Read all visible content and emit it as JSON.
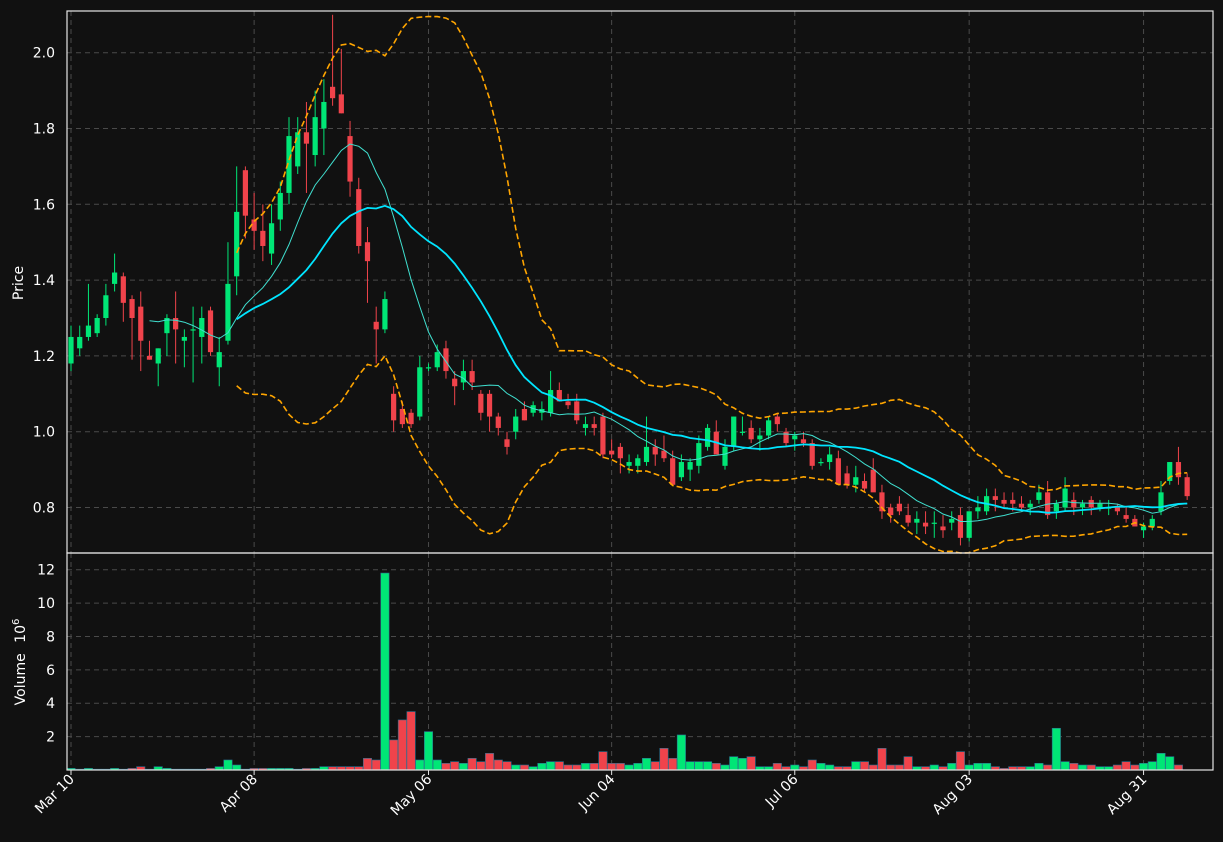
{
  "chart_data": {
    "type": "candlestick",
    "colors": {
      "up": "#00e676",
      "down": "#f0434b",
      "sma_fast": "#40e0d0",
      "sma_slow": "#00e5ff",
      "bollinger": "#ffa500",
      "background": "#111111",
      "grid": "#4a4a4a",
      "text": "#ffffff"
    },
    "price_axis": {
      "label": "Price",
      "ylim": [
        0.68,
        2.11
      ],
      "ticks": [
        "0.8",
        "1.0",
        "1.2",
        "1.4",
        "1.6",
        "1.8",
        "2.0"
      ],
      "grid": true
    },
    "volume_axis": {
      "label": "Volume",
      "exponent": "6",
      "ylim": [
        0,
        13
      ],
      "ticks": [
        "2",
        "4",
        "6",
        "8",
        "10",
        "12"
      ],
      "grid": true
    },
    "x_tick_labels": [
      {
        "label": "Mar 10",
        "index": 0
      },
      {
        "label": "Apr 08",
        "index": 21
      },
      {
        "label": "May 06",
        "index": 41
      },
      {
        "label": "Jun 04",
        "index": 62
      },
      {
        "label": "Jul 06",
        "index": 83
      },
      {
        "label": "Aug 03",
        "index": 103
      },
      {
        "label": "Aug 31",
        "index": 123
      }
    ],
    "ohlc": [
      [
        1.18,
        1.28,
        1.16,
        1.25
      ],
      [
        1.22,
        1.28,
        1.2,
        1.25
      ],
      [
        1.25,
        1.39,
        1.24,
        1.28
      ],
      [
        1.26,
        1.31,
        1.25,
        1.3
      ],
      [
        1.3,
        1.39,
        1.28,
        1.36
      ],
      [
        1.39,
        1.47,
        1.37,
        1.42
      ],
      [
        1.41,
        1.42,
        1.29,
        1.34
      ],
      [
        1.35,
        1.36,
        1.19,
        1.3
      ],
      [
        1.33,
        1.37,
        1.16,
        1.24
      ],
      [
        1.2,
        1.24,
        1.19,
        1.19
      ],
      [
        1.18,
        1.22,
        1.12,
        1.22
      ],
      [
        1.26,
        1.31,
        1.2,
        1.3
      ],
      [
        1.3,
        1.37,
        1.18,
        1.27
      ],
      [
        1.24,
        1.27,
        1.17,
        1.25
      ],
      [
        1.27,
        1.33,
        1.13,
        1.27
      ],
      [
        1.25,
        1.33,
        1.18,
        1.3
      ],
      [
        1.32,
        1.33,
        1.2,
        1.21
      ],
      [
        1.17,
        1.25,
        1.12,
        1.21
      ],
      [
        1.24,
        1.5,
        1.23,
        1.39
      ],
      [
        1.41,
        1.7,
        1.36,
        1.58
      ],
      [
        1.69,
        1.7,
        1.51,
        1.57
      ],
      [
        1.56,
        1.63,
        1.48,
        1.53
      ],
      [
        1.53,
        1.6,
        1.45,
        1.49
      ],
      [
        1.47,
        1.6,
        1.44,
        1.55
      ],
      [
        1.56,
        1.66,
        1.53,
        1.63
      ],
      [
        1.63,
        1.83,
        1.6,
        1.78
      ],
      [
        1.7,
        1.83,
        1.68,
        1.79
      ],
      [
        1.79,
        1.87,
        1.63,
        1.76
      ],
      [
        1.73,
        1.9,
        1.7,
        1.83
      ],
      [
        1.8,
        1.93,
        1.73,
        1.87
      ],
      [
        1.91,
        2.1,
        1.86,
        1.88
      ],
      [
        1.89,
        2.01,
        1.84,
        1.84
      ],
      [
        1.78,
        1.82,
        1.62,
        1.66
      ],
      [
        1.64,
        1.67,
        1.47,
        1.49
      ],
      [
        1.5,
        1.54,
        1.34,
        1.45
      ],
      [
        1.29,
        1.33,
        1.18,
        1.27
      ],
      [
        1.27,
        1.37,
        1.26,
        1.35
      ],
      [
        1.1,
        1.12,
        1.0,
        1.03
      ],
      [
        1.06,
        1.08,
        1.01,
        1.02
      ],
      [
        1.05,
        1.06,
        1.01,
        1.02
      ],
      [
        1.04,
        1.2,
        1.03,
        1.17
      ],
      [
        1.17,
        1.18,
        1.16,
        1.17
      ],
      [
        1.17,
        1.23,
        1.16,
        1.21
      ],
      [
        1.22,
        1.24,
        1.14,
        1.16
      ],
      [
        1.14,
        1.16,
        1.07,
        1.12
      ],
      [
        1.13,
        1.19,
        1.11,
        1.16
      ],
      [
        1.16,
        1.19,
        1.11,
        1.13
      ],
      [
        1.1,
        1.11,
        1.03,
        1.05
      ],
      [
        1.1,
        1.11,
        1.0,
        1.04
      ],
      [
        1.04,
        1.05,
        0.99,
        1.01
      ],
      [
        0.98,
        1.0,
        0.94,
        0.96
      ],
      [
        1.0,
        1.06,
        0.98,
        1.04
      ],
      [
        1.06,
        1.08,
        1.03,
        1.03
      ],
      [
        1.05,
        1.08,
        1.04,
        1.07
      ],
      [
        1.05,
        1.08,
        1.03,
        1.06
      ],
      [
        1.05,
        1.16,
        1.04,
        1.11
      ],
      [
        1.11,
        1.13,
        1.08,
        1.08
      ],
      [
        1.08,
        1.1,
        1.06,
        1.07
      ],
      [
        1.08,
        1.1,
        1.02,
        1.03
      ],
      [
        1.01,
        1.04,
        0.99,
        1.02
      ],
      [
        1.02,
        1.04,
        0.99,
        1.01
      ],
      [
        1.04,
        1.05,
        0.93,
        0.94
      ],
      [
        0.95,
        0.98,
        0.93,
        0.94
      ],
      [
        0.96,
        0.97,
        0.89,
        0.93
      ],
      [
        0.91,
        0.94,
        0.89,
        0.92
      ],
      [
        0.91,
        0.94,
        0.89,
        0.93
      ],
      [
        0.92,
        1.04,
        0.91,
        0.96
      ],
      [
        0.96,
        0.98,
        0.91,
        0.94
      ],
      [
        0.95,
        0.99,
        0.92,
        0.93
      ],
      [
        0.93,
        0.95,
        0.87,
        0.86
      ],
      [
        0.88,
        0.94,
        0.87,
        0.92
      ],
      [
        0.9,
        0.93,
        0.87,
        0.92
      ],
      [
        0.91,
        0.99,
        0.89,
        0.97
      ],
      [
        0.96,
        1.02,
        0.95,
        1.01
      ],
      [
        1.0,
        1.03,
        0.96,
        0.94
      ],
      [
        0.91,
        0.98,
        0.9,
        0.96
      ],
      [
        0.96,
        1.04,
        0.95,
        1.04
      ],
      [
        1.0,
        1.04,
        0.99,
        1.0
      ],
      [
        1.01,
        1.03,
        0.97,
        0.98
      ],
      [
        0.98,
        1.01,
        0.95,
        0.99
      ],
      [
        0.99,
        1.04,
        0.98,
        1.03
      ],
      [
        1.04,
        1.05,
        1.0,
        1.02
      ],
      [
        1.0,
        1.01,
        0.96,
        0.97
      ],
      [
        0.98,
        1.0,
        0.95,
        0.99
      ],
      [
        0.98,
        1.0,
        0.96,
        0.97
      ],
      [
        0.97,
        0.98,
        0.9,
        0.91
      ],
      [
        0.92,
        0.93,
        0.91,
        0.92
      ],
      [
        0.92,
        0.96,
        0.9,
        0.94
      ],
      [
        0.93,
        0.95,
        0.86,
        0.86
      ],
      [
        0.89,
        0.91,
        0.85,
        0.86
      ],
      [
        0.86,
        0.91,
        0.84,
        0.88
      ],
      [
        0.87,
        0.89,
        0.84,
        0.85
      ],
      [
        0.9,
        0.93,
        0.85,
        0.84
      ],
      [
        0.84,
        0.86,
        0.77,
        0.79
      ],
      [
        0.8,
        0.81,
        0.76,
        0.78
      ],
      [
        0.81,
        0.83,
        0.78,
        0.79
      ],
      [
        0.78,
        0.81,
        0.75,
        0.76
      ],
      [
        0.76,
        0.79,
        0.73,
        0.77
      ],
      [
        0.76,
        0.79,
        0.73,
        0.75
      ],
      [
        0.76,
        0.79,
        0.72,
        0.76
      ],
      [
        0.75,
        0.78,
        0.72,
        0.74
      ],
      [
        0.76,
        0.79,
        0.74,
        0.77
      ],
      [
        0.78,
        0.8,
        0.7,
        0.72
      ],
      [
        0.72,
        0.79,
        0.71,
        0.79
      ],
      [
        0.79,
        0.83,
        0.77,
        0.8
      ],
      [
        0.79,
        0.85,
        0.78,
        0.83
      ],
      [
        0.83,
        0.85,
        0.79,
        0.82
      ],
      [
        0.82,
        0.84,
        0.8,
        0.81
      ],
      [
        0.82,
        0.84,
        0.79,
        0.81
      ],
      [
        0.81,
        0.83,
        0.79,
        0.8
      ],
      [
        0.8,
        0.82,
        0.78,
        0.81
      ],
      [
        0.82,
        0.86,
        0.81,
        0.84
      ],
      [
        0.84,
        0.87,
        0.77,
        0.78
      ],
      [
        0.79,
        0.82,
        0.77,
        0.81
      ],
      [
        0.8,
        0.88,
        0.79,
        0.85
      ],
      [
        0.82,
        0.84,
        0.78,
        0.8
      ],
      [
        0.8,
        0.82,
        0.78,
        0.81
      ],
      [
        0.82,
        0.83,
        0.78,
        0.8
      ],
      [
        0.8,
        0.82,
        0.79,
        0.81
      ],
      [
        0.8,
        0.82,
        0.78,
        0.8
      ],
      [
        0.8,
        0.81,
        0.78,
        0.79
      ],
      [
        0.78,
        0.8,
        0.76,
        0.77
      ],
      [
        0.77,
        0.78,
        0.75,
        0.75
      ],
      [
        0.74,
        0.76,
        0.72,
        0.75
      ],
      [
        0.75,
        0.78,
        0.74,
        0.77
      ],
      [
        0.79,
        0.87,
        0.78,
        0.84
      ],
      [
        0.87,
        0.92,
        0.86,
        0.92
      ],
      [
        0.92,
        0.96,
        0.86,
        0.88
      ],
      [
        0.88,
        0.89,
        0.82,
        0.83
      ]
    ],
    "volume": [
      0.1,
      0.05,
      0.1,
      0.05,
      0.05,
      0.1,
      0.05,
      0.1,
      0.2,
      0.05,
      0.2,
      0.1,
      0.05,
      0.05,
      0.05,
      0.05,
      0.1,
      0.2,
      0.6,
      0.3,
      0.05,
      0.1,
      0.1,
      0.1,
      0.1,
      0.1,
      0.05,
      0.1,
      0.1,
      0.2,
      0.2,
      0.2,
      0.2,
      0.2,
      0.7,
      0.6,
      11.8,
      1.8,
      3.0,
      3.5,
      0.6,
      2.3,
      0.6,
      0.4,
      0.5,
      0.4,
      0.7,
      0.5,
      1.0,
      0.6,
      0.5,
      0.3,
      0.3,
      0.2,
      0.4,
      0.5,
      0.5,
      0.3,
      0.3,
      0.4,
      0.4,
      1.1,
      0.4,
      0.4,
      0.3,
      0.4,
      0.7,
      0.5,
      1.3,
      0.7,
      2.1,
      0.5,
      0.5,
      0.5,
      0.4,
      0.3,
      0.8,
      0.7,
      0.8,
      0.2,
      0.2,
      0.4,
      0.2,
      0.3,
      0.2,
      0.6,
      0.4,
      0.3,
      0.2,
      0.2,
      0.5,
      0.5,
      0.3,
      1.3,
      0.3,
      0.3,
      0.8,
      0.2,
      0.2,
      0.3,
      0.2,
      0.4,
      1.1,
      0.3,
      0.4,
      0.4,
      0.2,
      0.1,
      0.2,
      0.2,
      0.2,
      0.4,
      0.3,
      2.5,
      0.5,
      0.4,
      0.3,
      0.3,
      0.2,
      0.2,
      0.3,
      0.5,
      0.3,
      0.4,
      0.5,
      1.0,
      0.8,
      0.3
    ]
  }
}
